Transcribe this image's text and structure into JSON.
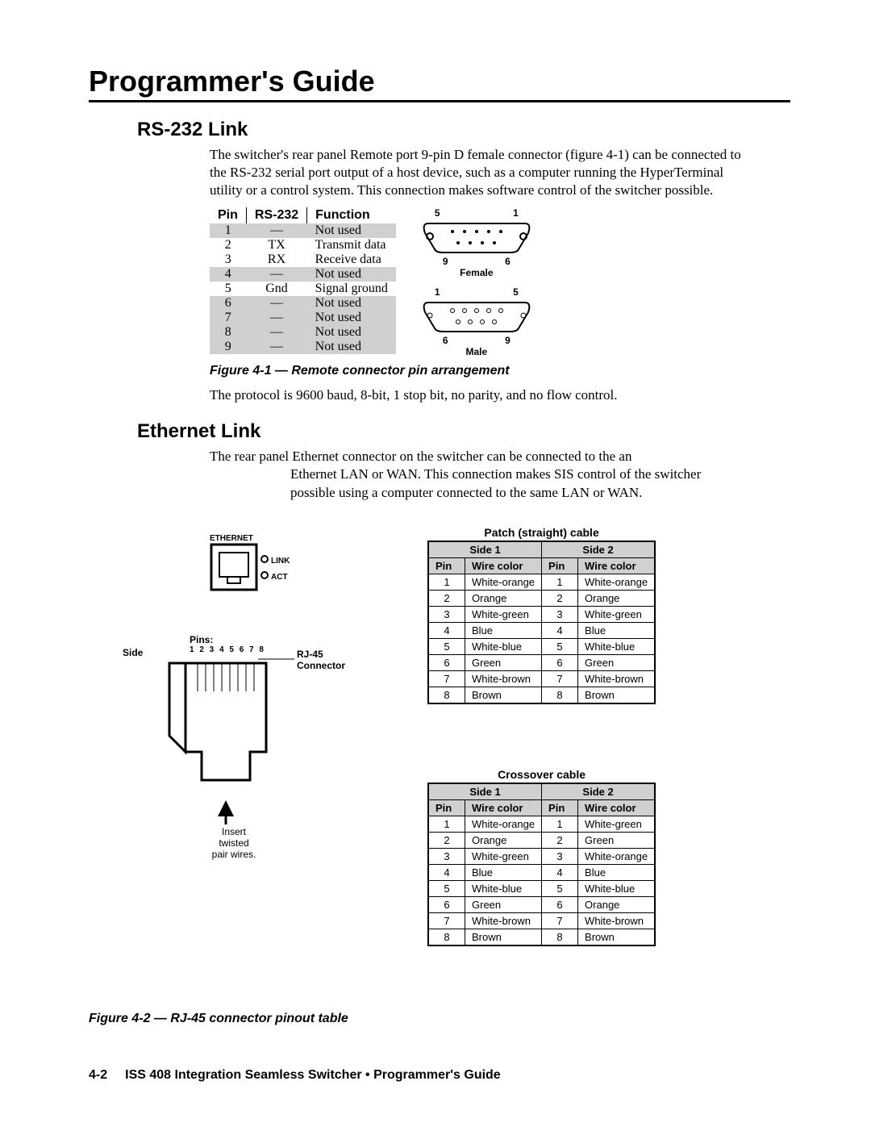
{
  "header": "Programmer's Guide",
  "sec1": {
    "title": "RS-232 Link",
    "p1": "The switcher's rear panel Remote port 9-pin D female connector (figure 4-1) can be connected to the RS-232 serial port output of a host device, such as a computer running the HyperTerminal utility or a control system.  This connection makes software control of the switcher possible.",
    "table": {
      "h1": "Pin",
      "h2": "RS-232",
      "h3": "Function",
      "rows": [
        {
          "pin": "1",
          "sig": "—",
          "fn": "Not used",
          "shade": true
        },
        {
          "pin": "2",
          "sig": "TX",
          "fn": "Transmit data",
          "shade": false
        },
        {
          "pin": "3",
          "sig": "RX",
          "fn": "Receive data",
          "shade": false
        },
        {
          "pin": "4",
          "sig": "—",
          "fn": "Not used",
          "shade": true
        },
        {
          "pin": "5",
          "sig": "Gnd",
          "fn": "Signal ground",
          "shade": false
        },
        {
          "pin": "6",
          "sig": "—",
          "fn": "Not used",
          "shade": true
        },
        {
          "pin": "7",
          "sig": "—",
          "fn": "Not used",
          "shade": true
        },
        {
          "pin": "8",
          "sig": "—",
          "fn": "Not used",
          "shade": true
        },
        {
          "pin": "9",
          "sig": "—",
          "fn": "Not used",
          "shade": true
        }
      ]
    },
    "conn": {
      "f_top_l": "5",
      "f_top_r": "1",
      "f_bot_l": "9",
      "f_bot_r": "6",
      "f_label": "Female",
      "m_top_l": "1",
      "m_top_r": "5",
      "m_bot_l": "6",
      "m_bot_r": "9",
      "m_label": "Male"
    },
    "caption": "Figure 4-1 — Remote connector pin arrangement",
    "p2": "The protocol is 9600 baud, 8-bit, 1 stop bit, no parity, and no flow control."
  },
  "sec2": {
    "title": "Ethernet Link",
    "p1a": "The rear panel Ethernet connector on the switcher can be connected to the an",
    "p1b": "Ethernet LAN or WAN.  This connection makes SIS control of the switcher possible using a computer connected to the same LAN or WAN.",
    "port": {
      "title": "ETHERNET",
      "led1": "LINK",
      "led2": "ACT"
    },
    "rj45": {
      "side": "Side",
      "pins": "Pins:",
      "nums": "1 2 3 4 5 6 7 8",
      "conn1": "RJ-45",
      "conn2": "Connector",
      "ins1": "Insert",
      "ins2": "twisted",
      "ins3": "pair wires."
    },
    "patch": {
      "caption": "Patch (straight) cable",
      "side1": "Side 1",
      "side2": "Side 2",
      "pin": "Pin",
      "wc": "Wire color",
      "rows": [
        {
          "p1": "1",
          "c1": "White-orange",
          "p2": "1",
          "c2": "White-orange"
        },
        {
          "p1": "2",
          "c1": "Orange",
          "p2": "2",
          "c2": "Orange"
        },
        {
          "p1": "3",
          "c1": "White-green",
          "p2": "3",
          "c2": "White-green"
        },
        {
          "p1": "4",
          "c1": "Blue",
          "p2": "4",
          "c2": "Blue"
        },
        {
          "p1": "5",
          "c1": "White-blue",
          "p2": "5",
          "c2": "White-blue"
        },
        {
          "p1": "6",
          "c1": "Green",
          "p2": "6",
          "c2": "Green"
        },
        {
          "p1": "7",
          "c1": "White-brown",
          "p2": "7",
          "c2": "White-brown"
        },
        {
          "p1": "8",
          "c1": "Brown",
          "p2": "8",
          "c2": "Brown"
        }
      ]
    },
    "cross": {
      "caption": "Crossover cable",
      "side1": "Side 1",
      "side2": "Side 2",
      "pin": "Pin",
      "wc": "Wire color",
      "rows": [
        {
          "p1": "1",
          "c1": "White-orange",
          "p2": "1",
          "c2": "White-green"
        },
        {
          "p1": "2",
          "c1": "Orange",
          "p2": "2",
          "c2": "Green"
        },
        {
          "p1": "3",
          "c1": "White-green",
          "p2": "3",
          "c2": "White-orange"
        },
        {
          "p1": "4",
          "c1": "Blue",
          "p2": "4",
          "c2": "Blue"
        },
        {
          "p1": "5",
          "c1": "White-blue",
          "p2": "5",
          "c2": "White-blue"
        },
        {
          "p1": "6",
          "c1": "Green",
          "p2": "6",
          "c2": "Orange"
        },
        {
          "p1": "7",
          "c1": "White-brown",
          "p2": "7",
          "c2": "White-brown"
        },
        {
          "p1": "8",
          "c1": "Brown",
          "p2": "8",
          "c2": "Brown"
        }
      ]
    },
    "caption": "Figure 4-2 — RJ-45 connector pinout table"
  },
  "footer": {
    "page": "4-2",
    "title": "ISS 408 Integration Seamless Switcher • Programmer's Guide"
  }
}
